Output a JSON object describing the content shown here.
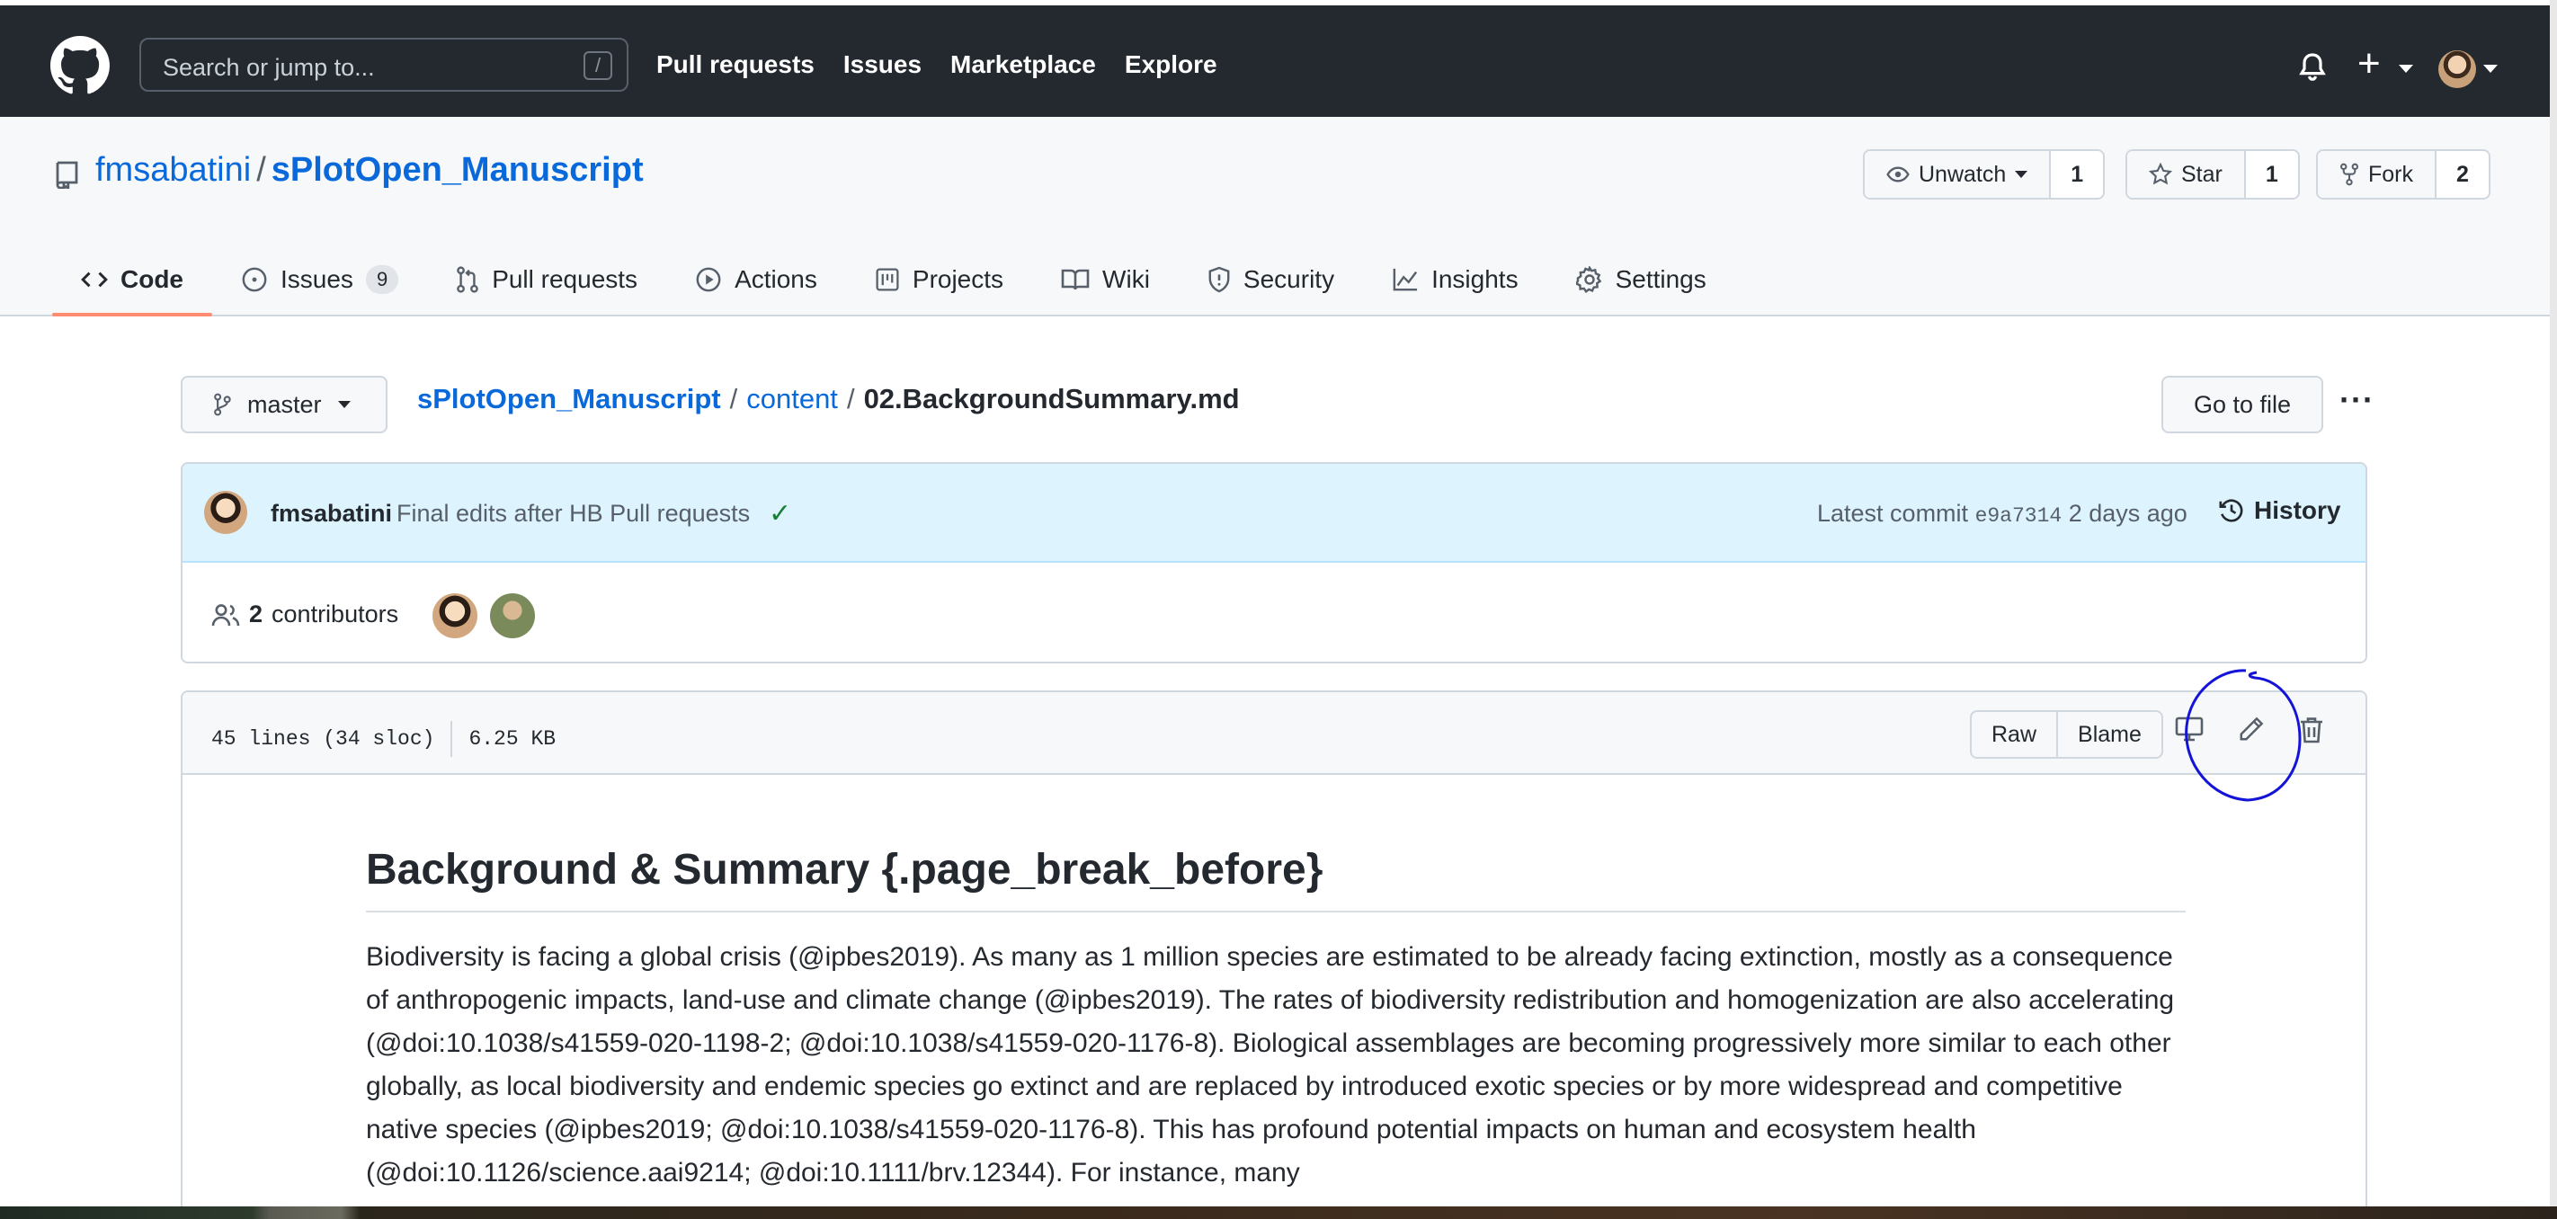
{
  "header": {
    "search_placeholder": "Search or jump to...",
    "search_shortcut": "/",
    "nav": [
      "Pull requests",
      "Issues",
      "Marketplace",
      "Explore"
    ],
    "plus_label": "+"
  },
  "repo": {
    "owner": "fmsabatini",
    "separator": "/",
    "name": "sPlotOpen_Manuscript",
    "watch": {
      "label": "Unwatch",
      "count": "1"
    },
    "star": {
      "label": "Star",
      "count": "1"
    },
    "fork": {
      "label": "Fork",
      "count": "2"
    }
  },
  "tabs": [
    {
      "label": "Code",
      "icon": "code-icon"
    },
    {
      "label": "Issues",
      "count": "9",
      "icon": "issue-icon"
    },
    {
      "label": "Pull requests",
      "icon": "pull-request-icon"
    },
    {
      "label": "Actions",
      "icon": "play-icon"
    },
    {
      "label": "Projects",
      "icon": "project-icon"
    },
    {
      "label": "Wiki",
      "icon": "book-icon"
    },
    {
      "label": "Security",
      "icon": "shield-icon"
    },
    {
      "label": "Insights",
      "icon": "graph-icon"
    },
    {
      "label": "Settings",
      "icon": "gear-icon"
    }
  ],
  "file_nav": {
    "branch": "master",
    "crumbs": [
      "sPlotOpen_Manuscript",
      "content"
    ],
    "crumb_sep": "/",
    "file": "02.BackgroundSummary.md",
    "goto_file": "Go to file",
    "more": "···"
  },
  "commit": {
    "author": "fmsabatini",
    "message": "Final edits after HB Pull requests",
    "check": "✓",
    "latest_prefix": "Latest commit",
    "sha": "e9a7314",
    "when": "2 days ago",
    "history": "History"
  },
  "contributors": {
    "count": "2",
    "label": "contributors"
  },
  "file": {
    "lines": "45 lines (34 sloc)",
    "size": "6.25 KB",
    "raw": "Raw",
    "blame": "Blame"
  },
  "content": {
    "heading": "Background & Summary {.page_break_before}",
    "paragraph": "Biodiversity is facing a global crisis (@ipbes2019). As many as 1 million species are estimated to be already facing extinction, mostly as a consequence of anthropogenic impacts, land-use and climate change (@ipbes2019). The rates of biodiversity redistribution and homogenization are also accelerating (@doi:10.1038/s41559-020-1198-2; @doi:10.1038/s41559-020-1176-8). Biological assemblages are becoming progressively more similar to each other globally, as local biodiversity and endemic species go extinct and are replaced by introduced exotic species or by more widespread and competitive native species (@ipbes2019; @doi:10.1038/s41559-020-1176-8). This has profound potential impacts on human and ecosystem health (@doi:10.1126/science.aai9214; @doi:10.1111/brv.12344). For instance, many"
  },
  "colors": {
    "header_bg": "#24292f",
    "link": "#0969da",
    "commit_bg": "#ddf4ff",
    "tab_underline": "#fd8c73",
    "check": "#1a7f37",
    "annotation": "#1414d8"
  }
}
